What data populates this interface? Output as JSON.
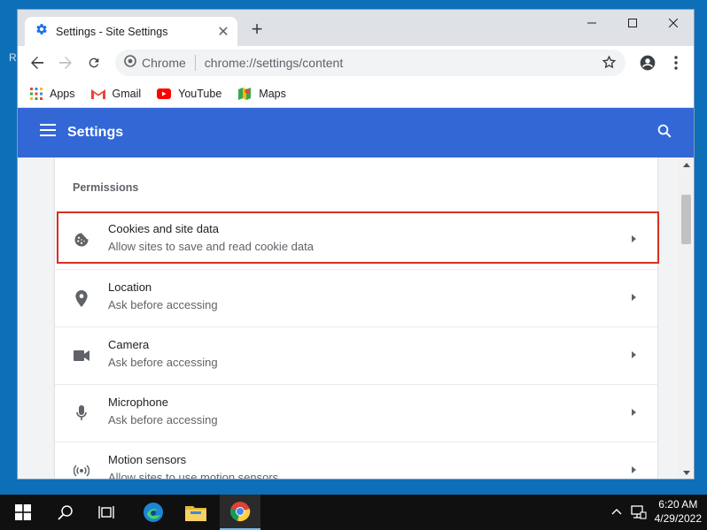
{
  "browser": {
    "tab_title": "Settings - Site Settings",
    "omnibox_label": "Chrome",
    "url": "chrome://settings/content"
  },
  "bookmarks": [
    {
      "label": "Apps",
      "icon": "apps-grid-icon"
    },
    {
      "label": "Gmail",
      "icon": "gmail-icon"
    },
    {
      "label": "YouTube",
      "icon": "youtube-icon"
    },
    {
      "label": "Maps",
      "icon": "maps-icon"
    }
  ],
  "header": {
    "title": "Settings"
  },
  "permissions": {
    "section_label": "Permissions",
    "items": [
      {
        "title": "Cookies and site data",
        "subtitle": "Allow sites to save and read cookie data",
        "icon": "cookie-icon"
      },
      {
        "title": "Location",
        "subtitle": "Ask before accessing",
        "icon": "location-pin-icon"
      },
      {
        "title": "Camera",
        "subtitle": "Ask before accessing",
        "icon": "camera-icon"
      },
      {
        "title": "Microphone",
        "subtitle": "Ask before accessing",
        "icon": "microphone-icon"
      },
      {
        "title": "Motion sensors",
        "subtitle": "Allow sites to use motion sensors",
        "icon": "motion-sensor-icon"
      }
    ]
  },
  "taskbar": {
    "time": "6:20 AM",
    "date": "4/29/2022"
  },
  "desktop": {
    "edge_letter": "R"
  },
  "colors": {
    "header_blue": "#3367d6",
    "highlight_red": "#d93025",
    "desktop_blue": "#0d6fb8"
  }
}
